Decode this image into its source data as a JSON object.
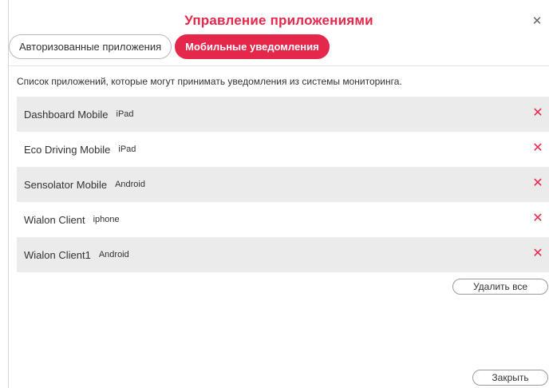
{
  "dialog": {
    "title": "Управление приложениями",
    "close_icon": "close-icon"
  },
  "tabs": [
    {
      "label": "Авторизованные приложения",
      "active": false
    },
    {
      "label": "Мобильные уведомления",
      "active": true
    }
  ],
  "description": "Список приложений, которые могут принимать уведомления из системы мониторинга.",
  "apps": [
    {
      "name": "Dashboard Mobile",
      "platform": "iPad"
    },
    {
      "name": "Eco Driving Mobile",
      "platform": "iPad"
    },
    {
      "name": "Sensolator Mobile",
      "platform": "Android"
    },
    {
      "name": "Wialon Client",
      "platform": "iphone"
    },
    {
      "name": "Wialon Client1",
      "platform": "Android"
    }
  ],
  "buttons": {
    "delete_all": "Удалить все",
    "close": "Закрыть"
  },
  "colors": {
    "accent": "#e4274a",
    "row_alt": "#ebebeb"
  }
}
